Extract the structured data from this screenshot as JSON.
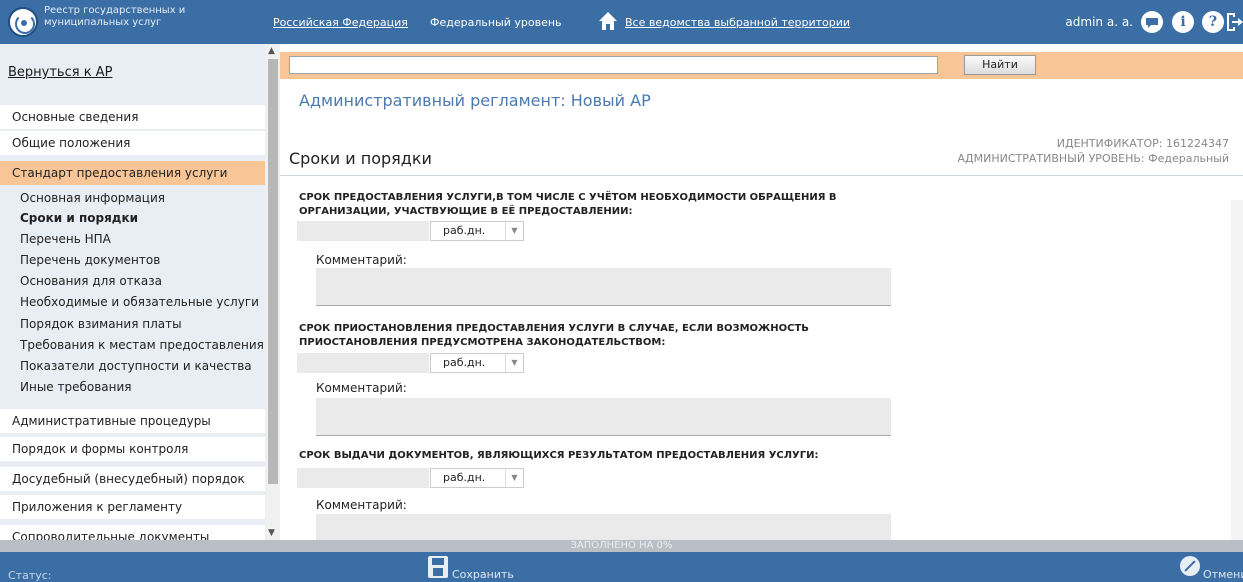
{
  "header": {
    "brand_line1": "Реестр государственных и",
    "brand_line2": "муниципальных услуг",
    "region": "Российская Федерация",
    "level": "Федеральный уровень",
    "agencies": "Все ведомства выбранной территории",
    "user": "admin a. a.",
    "icons": [
      "chat-icon",
      "info-icon",
      "help-icon",
      "logout-icon"
    ]
  },
  "sidebar": {
    "back": "Вернуться к АР",
    "top_items": [
      {
        "label": "Основные сведения"
      },
      {
        "label": "Общие положения"
      },
      {
        "label": "Стандарт предоставления услуги",
        "active": true
      }
    ],
    "sub_items": [
      {
        "label": "Основная информация"
      },
      {
        "label": "Сроки и порядки",
        "current": true
      },
      {
        "label": "Перечень НПА"
      },
      {
        "label": "Перечень документов"
      },
      {
        "label": "Основания для отказа"
      },
      {
        "label": "Необходимые и обязательные услуги"
      },
      {
        "label": "Порядок взимания платы"
      },
      {
        "label": "Требования к местам предоставления"
      },
      {
        "label": "Показатели доступности и качества"
      },
      {
        "label": "Иные требования"
      }
    ],
    "bottom_items": [
      {
        "label": "Административные процедуры"
      },
      {
        "label": "Порядок и формы контроля"
      },
      {
        "label": "Досудебный (внесудебный) порядок"
      },
      {
        "label": "Приложения к регламенту"
      },
      {
        "label": "Сопроводительные документы"
      }
    ]
  },
  "search": {
    "value": "",
    "button": "Найти"
  },
  "main": {
    "doc_title": "Административный регламент: Новый АР",
    "section_title": "Сроки и порядки",
    "identifier": "ИДЕНТИФИКАТОР: 161224347",
    "admin_level": "АДМИНИСТРАТИВНЫЙ УРОВЕНЬ: Федеральный",
    "questions": [
      {
        "label": "СРОК ПРЕДОСТАВЛЕНИЯ УСЛУГИ,В ТОМ ЧИСЛЕ С УЧЁТОМ НЕОБХОДИМОСТИ ОБРАЩЕНИЯ В ОРГАНИЗАЦИИ, УЧАСТВУЮЩИЕ В ЕЁ ПРЕДОСТАВЛЕНИИ:",
        "unit": "раб.дн.",
        "comment_label": "Комментарий:"
      },
      {
        "label": "СРОК ПРИОСТАНОВЛЕНИЯ ПРЕДОСТАВЛЕНИЯ УСЛУГИ В СЛУЧАЕ, ЕСЛИ ВОЗМОЖНОСТЬ ПРИОСТАНОВЛЕНИЯ ПРЕДУСМОТРЕНА ЗАКОНОДАТЕЛЬСТВОМ:",
        "unit": "раб.дн.",
        "comment_label": "Комментарий:"
      },
      {
        "label": "СРОК ВЫДАЧИ ДОКУМЕНТОВ, ЯВЛЯЮЩИХСЯ РЕЗУЛЬТАТОМ ПРЕДОСТАВЛЕНИЯ УСЛУГИ:",
        "unit": "раб.дн.",
        "comment_label": "Комментарий:"
      }
    ]
  },
  "footer": {
    "progress": "ЗАПОЛНЕНО НА 0%",
    "progress_value": 0,
    "status": "Статус:",
    "save": "Сохранить",
    "cancel": "Отменить"
  },
  "colors": {
    "header_bg": "#3a6ea5",
    "accent_orange": "#f7c596",
    "sidebar_bg": "#e9eef4",
    "title_blue": "#4a7ab0"
  }
}
